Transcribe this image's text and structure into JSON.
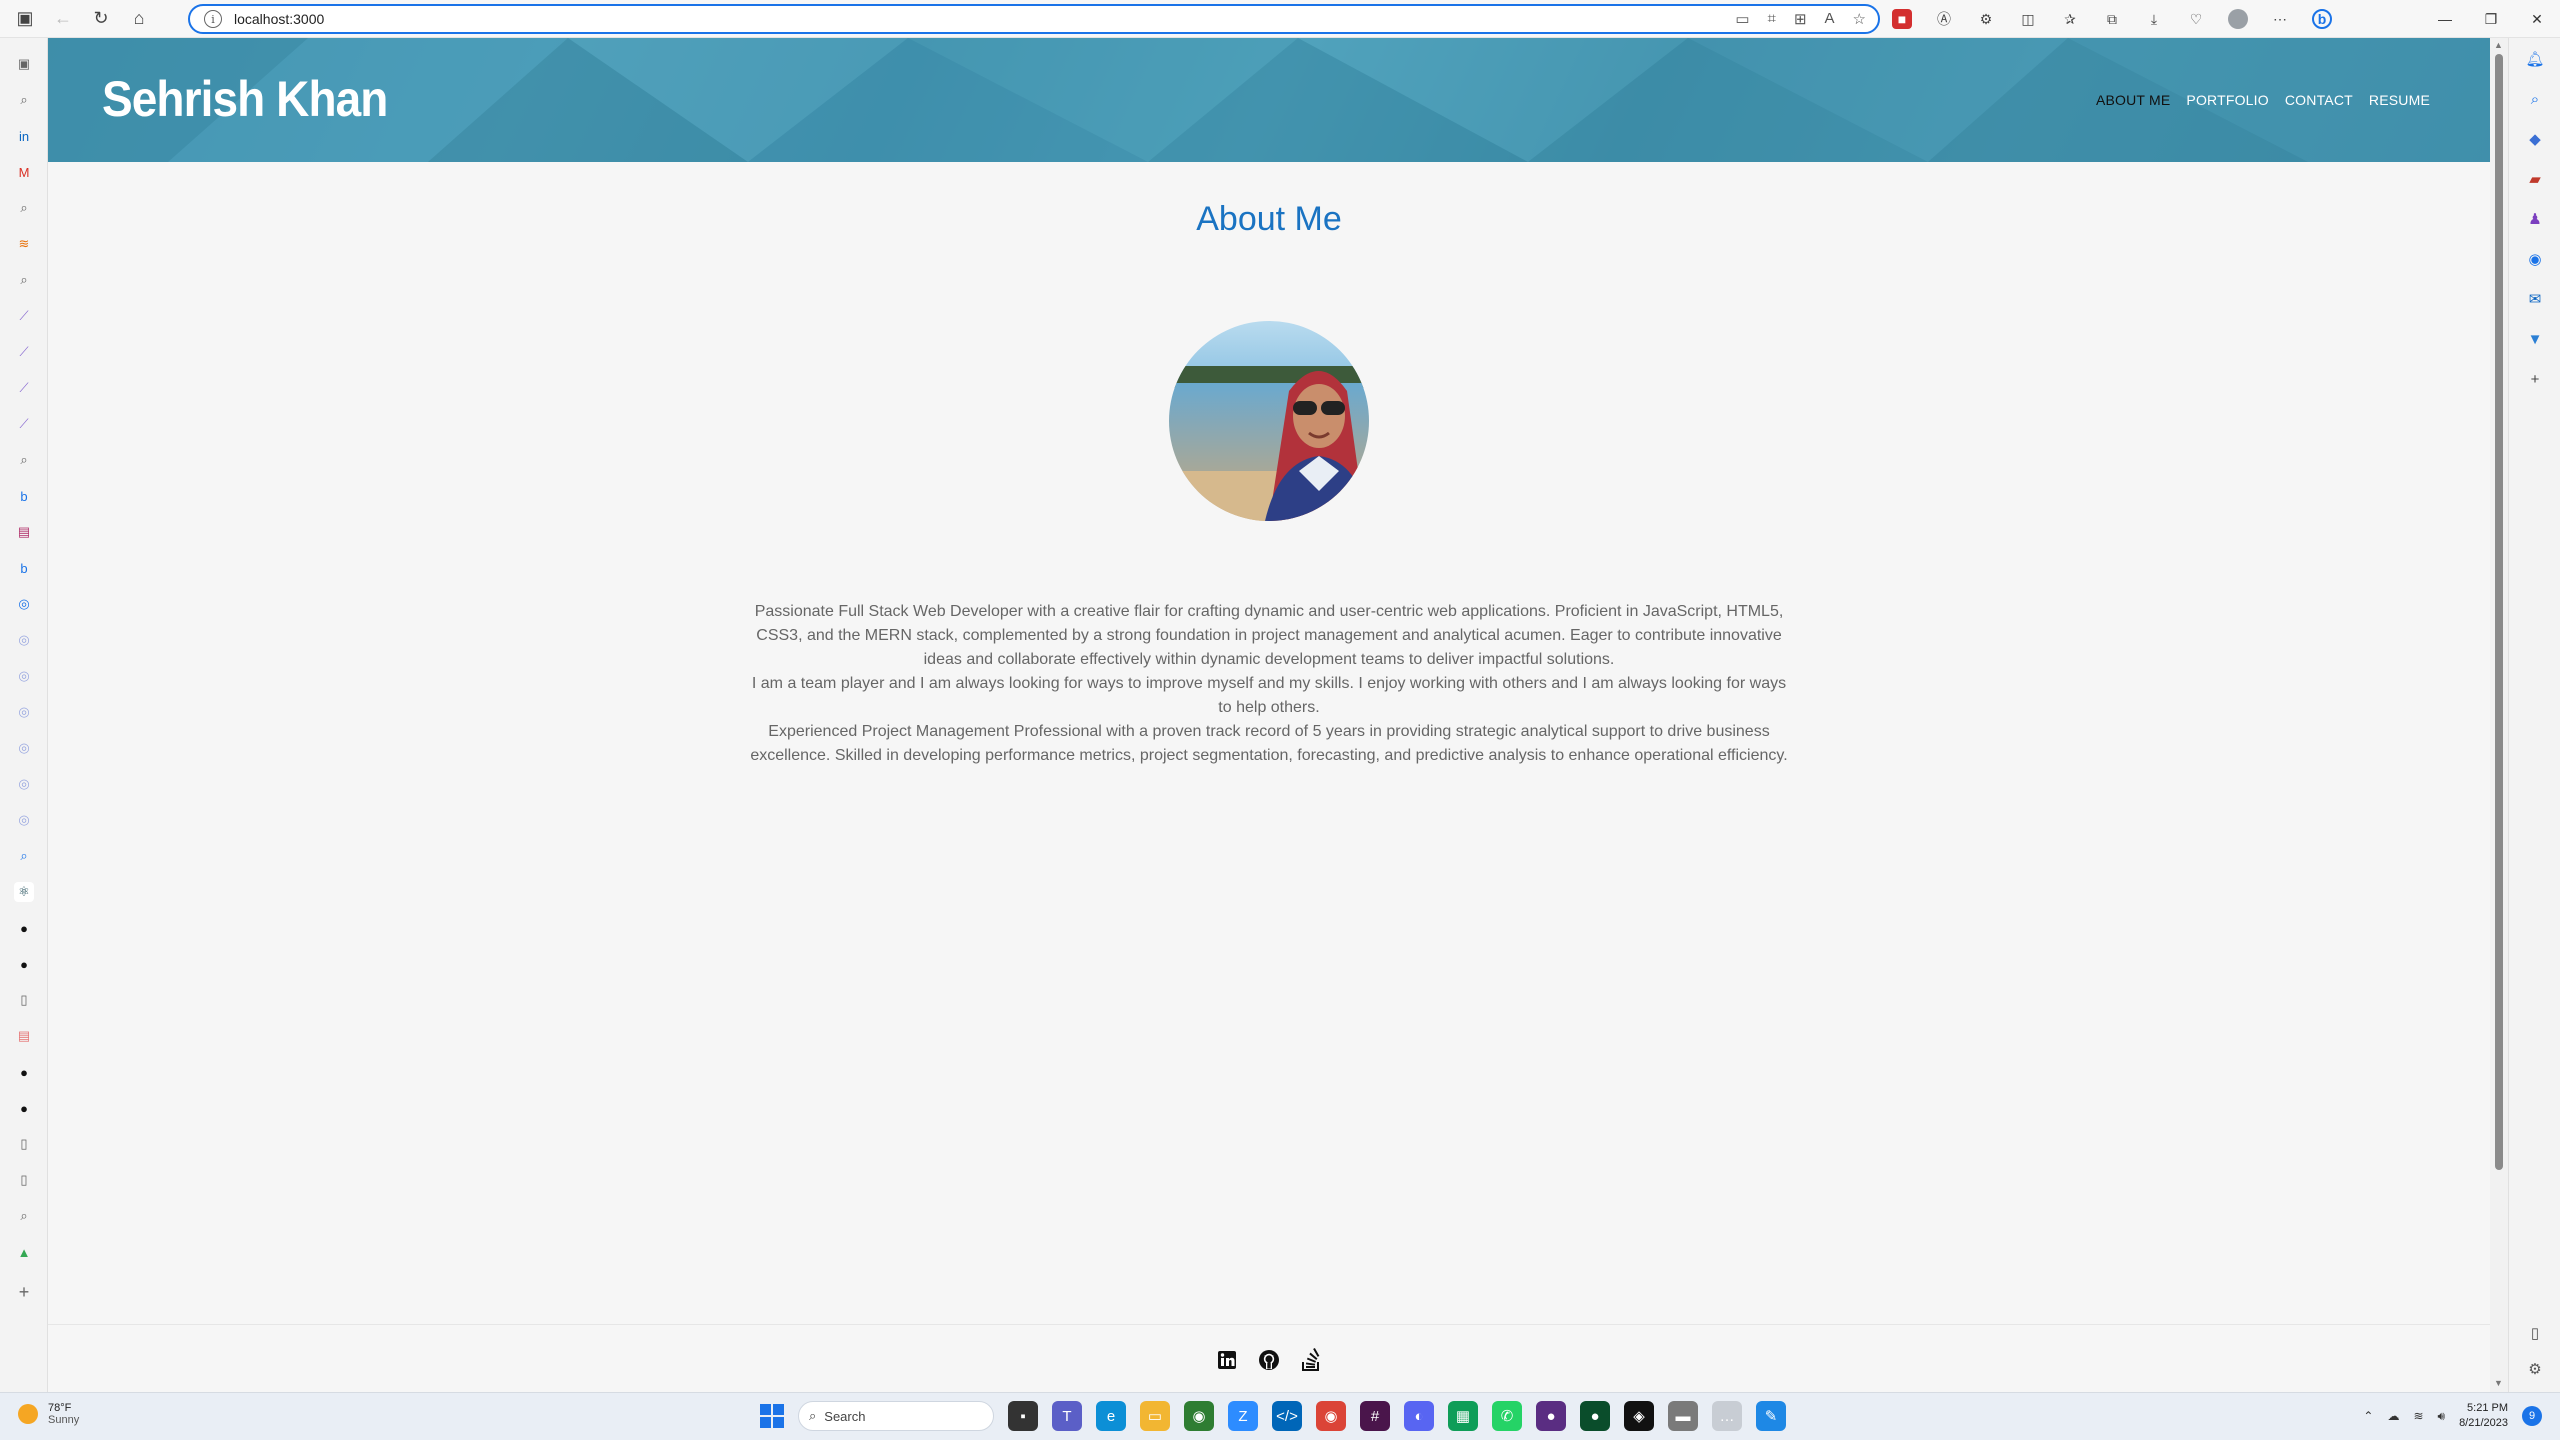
{
  "browser": {
    "url": "localhost:3000"
  },
  "site": {
    "name": "Sehrish Khan",
    "nav": [
      {
        "label": "ABOUT ME",
        "active": true
      },
      {
        "label": "PORTFOLIO",
        "active": false
      },
      {
        "label": "CONTACT",
        "active": false
      },
      {
        "label": "RESUME",
        "active": false
      }
    ]
  },
  "about": {
    "title": "About Me",
    "paragraphs": [
      "Passionate Full Stack Web Developer with a creative flair for crafting dynamic and user-centric web applications. Proficient in JavaScript, HTML5, CSS3, and the MERN stack, complemented by a strong foundation in project management and analytical acumen. Eager to contribute innovative ideas and collaborate effectively within dynamic development teams to deliver impactful solutions.",
      "I am a team player and I am always looking for ways to improve myself and my skills. I enjoy working with others and I am always looking for ways to help others.",
      "Experienced Project Management Professional with a proven track record of 5 years in providing strategic analytical support to drive business excellence. Skilled in developing performance metrics, project segmentation, forecasting, and predictive analysis to enhance operational efficiency."
    ]
  },
  "footer": {
    "icons": [
      "linkedin-icon",
      "github-icon",
      "stack-overflow-icon"
    ]
  },
  "taskbar": {
    "weather_temp": "78°F",
    "weather_desc": "Sunny",
    "search_placeholder": "Search",
    "time": "5:21 PM",
    "date": "8/21/2023",
    "notification_count": "9"
  },
  "colors": {
    "accent": "#1a73c2",
    "hero": "#4597b2"
  }
}
